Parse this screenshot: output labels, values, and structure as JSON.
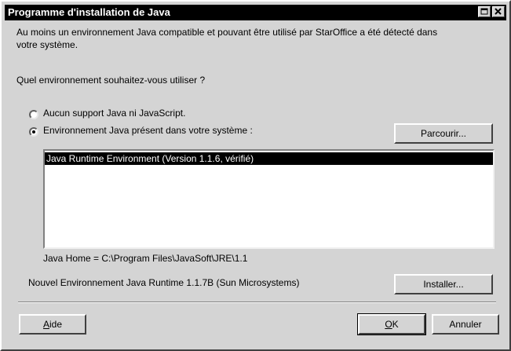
{
  "window": {
    "title": "Programme d'installation de Java"
  },
  "intro": {
    "line1": "Au moins un environnement Java compatible et pouvant être utilisé par StarOffice a été détecté dans",
    "line2": "votre système."
  },
  "question": "Quel environnement souhaitez-vous utiliser ?",
  "options": {
    "none": {
      "label": "Aucun support Java ni JavaScript.",
      "selected": false
    },
    "present": {
      "label": "Environnement Java présent dans votre système :",
      "selected": true
    }
  },
  "buttons": {
    "browse": "Parcourir...",
    "install": "Installer...",
    "help_prefix": "A",
    "help_rest": "ide",
    "ok_prefix": "O",
    "ok_rest": "K",
    "cancel": "Annuler"
  },
  "list": {
    "items": [
      "Java Runtime Environment (Version 1.1.6, vérifié)"
    ],
    "selected_index": 0
  },
  "java_home": "Java Home = C:\\Program Files\\JavaSoft\\JRE\\1.1",
  "new_runtime": "Nouvel Environnement Java Runtime 1.1.7B (Sun Microsystems)",
  "colors": {
    "titlebar": "#000000",
    "face": "#d4d4d4",
    "selection": "#000000"
  },
  "icons": {
    "maximize": "maximize-icon",
    "close": "close-icon"
  }
}
